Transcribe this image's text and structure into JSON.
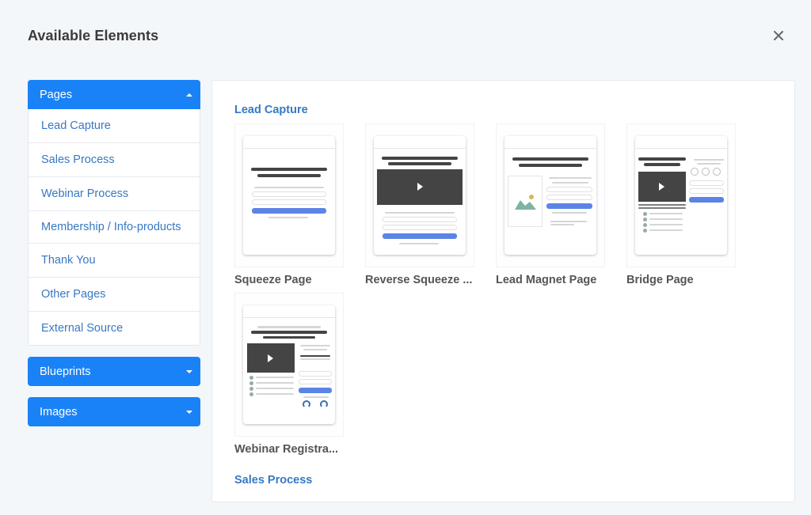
{
  "modal": {
    "title": "Available Elements",
    "close_icon": "close-icon"
  },
  "sidebar": {
    "sections": [
      {
        "label": "Pages",
        "expanded": true,
        "caret_icon": "caret-up-icon",
        "items": [
          {
            "label": "Lead Capture"
          },
          {
            "label": "Sales Process"
          },
          {
            "label": "Webinar Process"
          },
          {
            "label": "Membership / Info-products"
          },
          {
            "label": "Thank You"
          },
          {
            "label": "Other Pages"
          },
          {
            "label": "External Source"
          }
        ]
      },
      {
        "label": "Blueprints",
        "expanded": false,
        "caret_icon": "caret-down-icon"
      },
      {
        "label": "Images",
        "expanded": false,
        "caret_icon": "caret-down-icon"
      }
    ]
  },
  "main": {
    "sections": [
      {
        "title": "Lead Capture",
        "templates": [
          {
            "label": "Squeeze Page",
            "thumbnail_icon": "squeeze-page-preview"
          },
          {
            "label": "Reverse Squeeze ...",
            "thumbnail_icon": "reverse-squeeze-page-preview"
          },
          {
            "label": "Lead Magnet Page",
            "thumbnail_icon": "lead-magnet-page-preview"
          },
          {
            "label": "Bridge Page",
            "thumbnail_icon": "bridge-page-preview"
          },
          {
            "label": "Webinar Registra...",
            "thumbnail_icon": "webinar-registration-page-preview"
          }
        ]
      },
      {
        "title": "Sales Process"
      }
    ]
  },
  "colors": {
    "accent": "#1a82f7",
    "link": "#3778c2",
    "section_title": "#3579c4",
    "background": "#f4f7fa"
  }
}
